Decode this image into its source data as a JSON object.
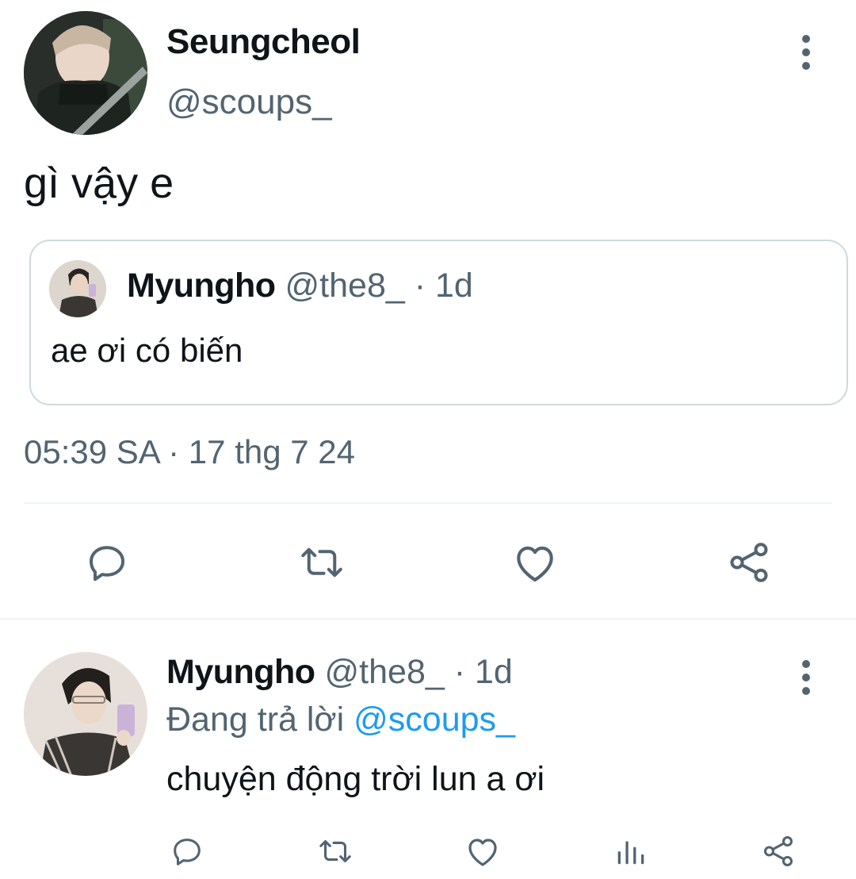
{
  "main_tweet": {
    "display_name": "Seungcheol",
    "handle": "@scoups_",
    "text": "gì vậy e",
    "timestamp": "05:39 SA · 17 thg 7 24",
    "quoted": {
      "display_name": "Myungho",
      "handle": "@the8_",
      "time": " · 1d",
      "text": "ae ơi có biến"
    },
    "actions": [
      "reply-icon",
      "retweet-icon",
      "like-icon",
      "share-icon"
    ]
  },
  "reply_tweet": {
    "display_name": "Myungho",
    "handle": "@the8_",
    "time": " · 1d",
    "replying_prefix": "Đang trả lời ",
    "replying_mention": "@scoups_",
    "text": "chuyện động trời lun a ơi",
    "actions": [
      "reply-icon",
      "retweet-icon",
      "like-icon",
      "views-icon",
      "share-icon"
    ]
  },
  "colors": {
    "text": "#0f1419",
    "secondary": "#536471",
    "mention": "#1d9bf0",
    "border": "#cfd9de"
  }
}
